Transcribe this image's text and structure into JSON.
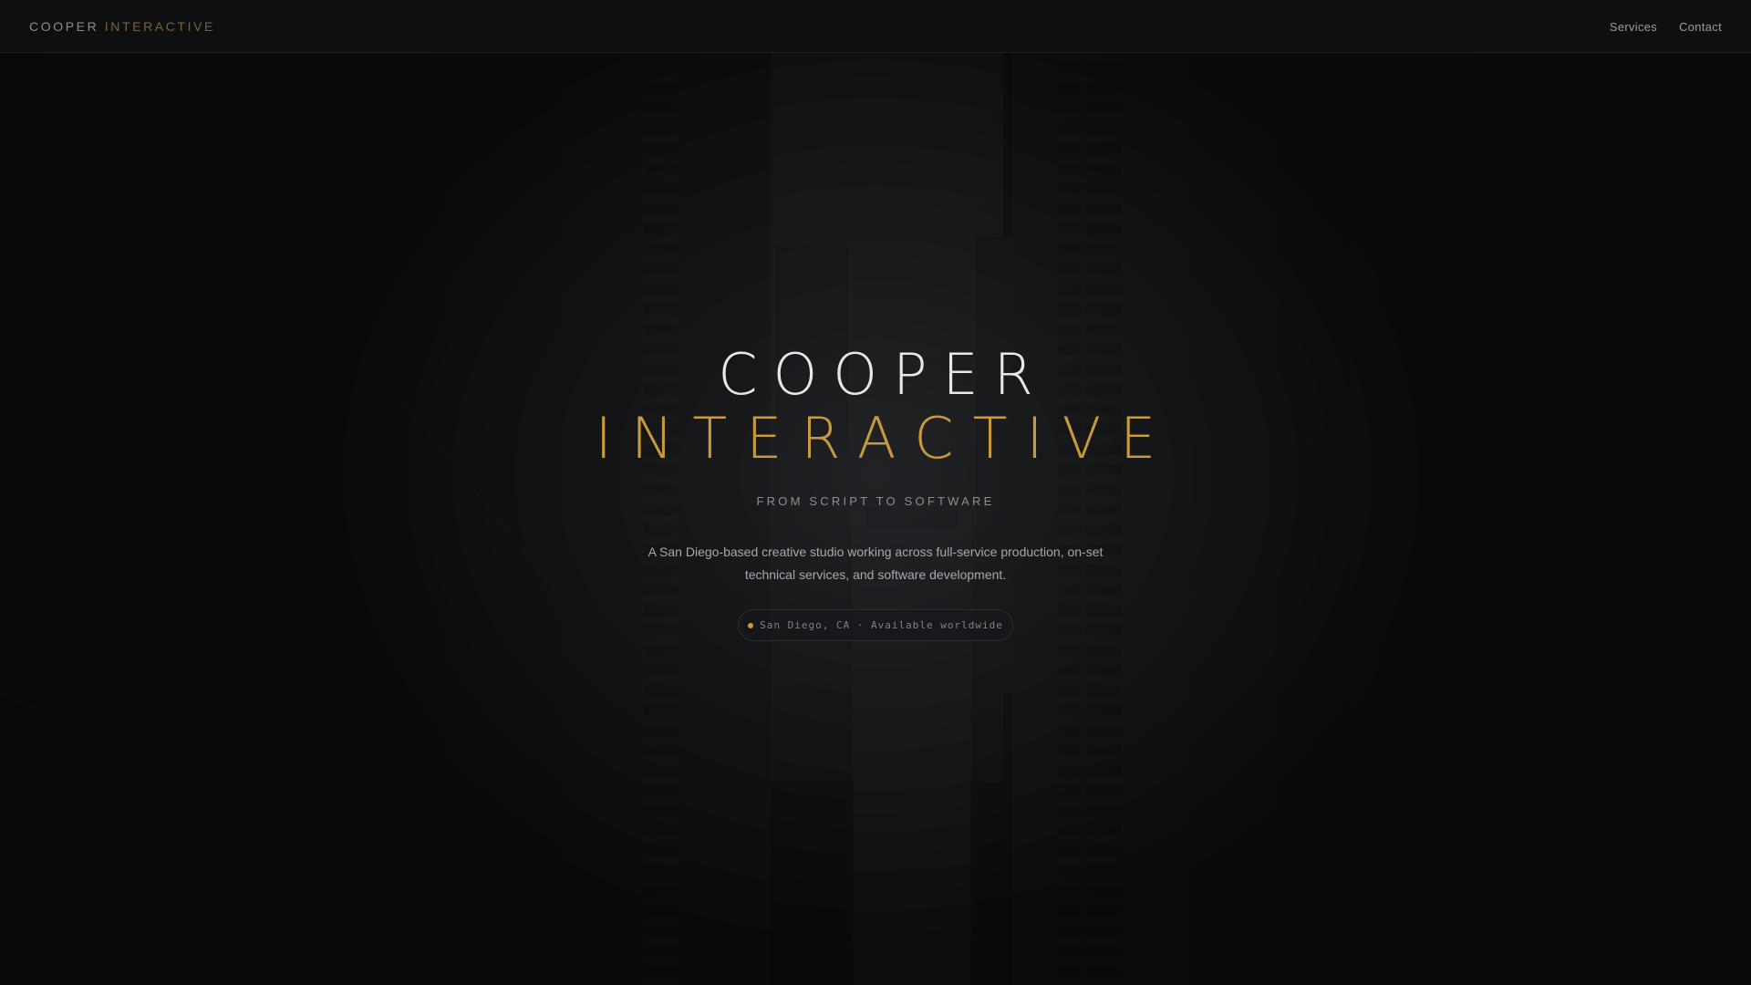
{
  "nav": {
    "brand_part1": "COOPER",
    "brand_part2": "INTERACTIVE",
    "links": [
      {
        "label": "Services"
      },
      {
        "label": "Contact"
      }
    ]
  },
  "hero": {
    "title_line1": "COOPER",
    "title_line2": "INTERACTIVE",
    "tagline": "FROM SCRIPT TO SOFTWARE",
    "description": "A San Diego-based creative studio working across full-service production, on-set technical services, and software development.",
    "location": "San Diego, CA · Available worldwide"
  },
  "colors": {
    "accent": "#c89a3e",
    "background": "#1a1b1e",
    "nav_background": "#0e0f11",
    "title_text": "#e8e8e8"
  },
  "background_image": "city-street-between-skyscrapers"
}
